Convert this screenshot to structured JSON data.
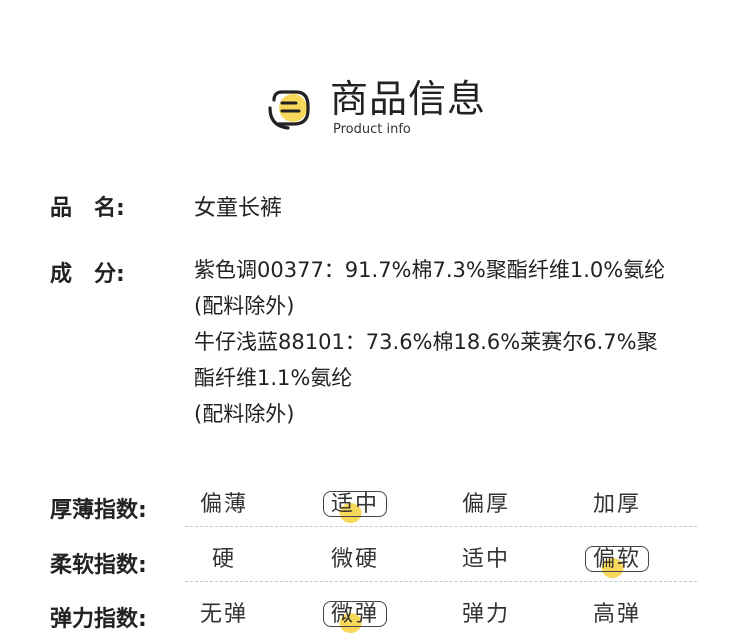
{
  "header": {
    "title": "商品信息",
    "subtitle": "Product info",
    "icon": "document-lines-icon",
    "accent": "#f7d85a"
  },
  "name_row": {
    "label": "品　名:",
    "value": "女童长裤"
  },
  "composition_row": {
    "label": "成　分:",
    "lines": [
      "紫色调00377：91.7%棉7.3%聚酯纤维1.0%氨纶",
      "(配料除外)",
      "牛仔浅蓝88101：73.6%棉18.6%莱赛尔6.7%聚",
      "酯纤维1.1%氨纶",
      "(配料除外)"
    ]
  },
  "scales": [
    {
      "label": "厚薄指数:",
      "options": [
        "偏薄",
        "适中",
        "偏厚",
        "加厚"
      ],
      "selected": 1
    },
    {
      "label": "柔软指数:",
      "options": [
        "硬",
        "微硬",
        "适中",
        "偏软"
      ],
      "selected": 3
    },
    {
      "label": "弹力指数:",
      "options": [
        "无弹",
        "微弹",
        "弹力",
        "高弹"
      ],
      "selected": 1
    }
  ]
}
